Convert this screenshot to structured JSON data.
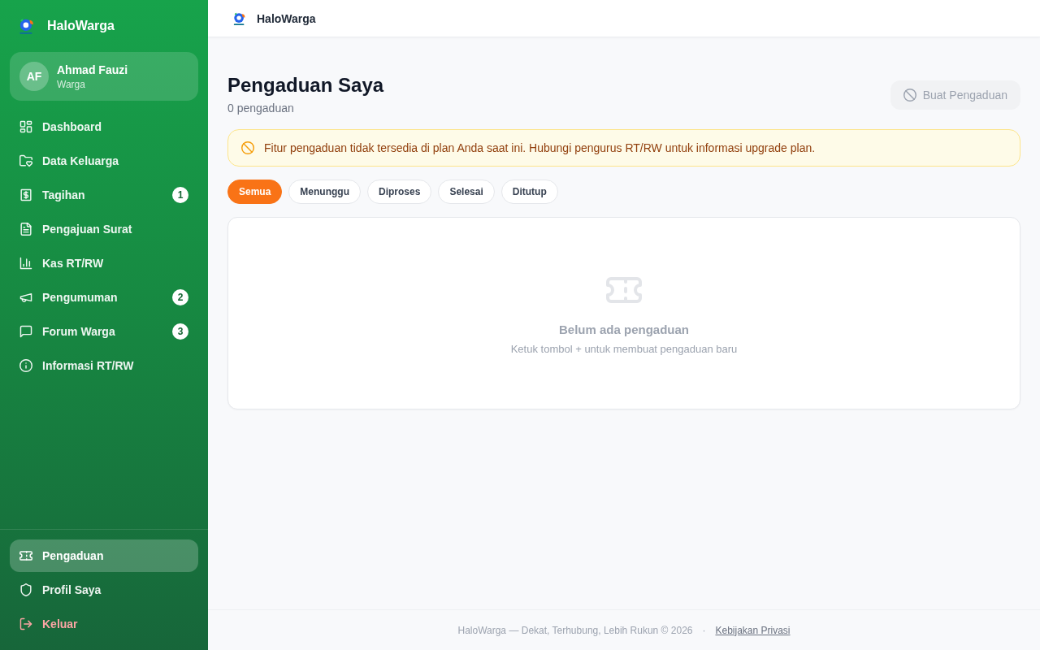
{
  "sidebar": {
    "brand": "HaloWarga",
    "user": {
      "initials": "AF",
      "name": "Ahmad Fauzi",
      "role": "Warga"
    },
    "nav": [
      {
        "label": "Dashboard",
        "selected": false
      },
      {
        "label": "Data Keluarga",
        "selected": false
      },
      {
        "label": "Tagihan",
        "selected": false,
        "badge": "1"
      },
      {
        "label": "Pengajuan Surat",
        "selected": false
      },
      {
        "label": "Kas RT/RW",
        "selected": false
      },
      {
        "label": "Pengumuman",
        "selected": false,
        "badge": "2"
      },
      {
        "label": "Forum Warga",
        "selected": false,
        "badge": "3"
      },
      {
        "label": "Informasi RT/RW",
        "selected": false
      }
    ],
    "bottom_nav": [
      {
        "label": "Pengaduan",
        "selected": true,
        "kind": "nav"
      },
      {
        "label": "Profil Saya",
        "selected": false,
        "kind": "nav"
      },
      {
        "label": "Keluar",
        "selected": false,
        "kind": "logout"
      }
    ]
  },
  "topbar": {
    "brand": "HaloWarga"
  },
  "page": {
    "title": "Pengaduan Saya",
    "subtitle": "0 pengaduan",
    "button": {
      "label": "Buat Pengaduan",
      "disabled": true
    }
  },
  "alert": {
    "text": "Fitur pengaduan tidak tersedia di plan Anda saat ini. Hubungi pengurus RT/RW untuk informasi upgrade plan."
  },
  "filters": [
    {
      "label": "Semua",
      "selected": true
    },
    {
      "label": "Menunggu",
      "selected": false
    },
    {
      "label": "Diproses",
      "selected": false
    },
    {
      "label": "Selesai",
      "selected": false
    },
    {
      "label": "Ditutup",
      "selected": false
    }
  ],
  "empty_state": {
    "title": "Belum ada pengaduan",
    "hint": "Ketuk tombol + untuk membuat pengaduan baru"
  },
  "footer": {
    "text": "HaloWarga — Dekat, Terhubung, Lebih Rukun © 2026",
    "separator": "·",
    "link": "Kebijakan Privasi"
  }
}
